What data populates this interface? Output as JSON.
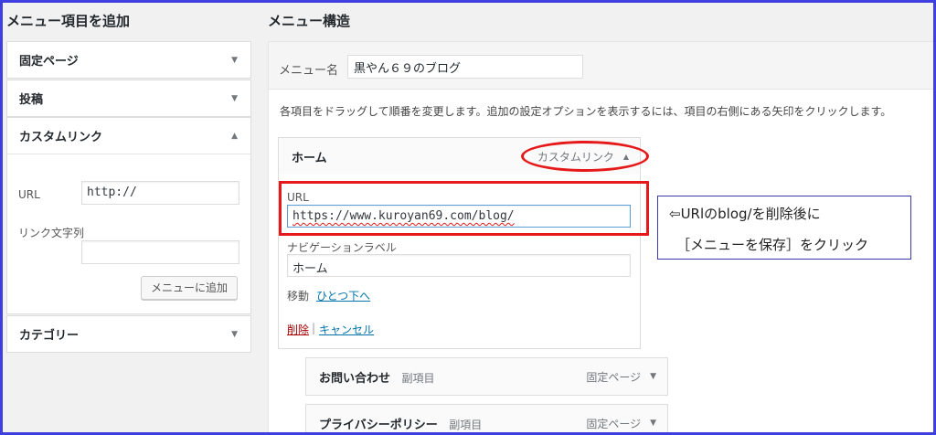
{
  "left": {
    "title": "メニュー項目を追加",
    "sections": {
      "pages": "固定ページ",
      "posts": "投稿",
      "custom_links": "カスタムリンク",
      "categories": "カテゴリー"
    },
    "custom_link_form": {
      "url_label": "URL",
      "url_value": "http://",
      "link_text_label": "リンク文字列",
      "link_text_value": "",
      "add_button": "メニューに追加"
    }
  },
  "right": {
    "title": "メニュー構造",
    "menu_name_label": "メニュー名",
    "menu_name_value": "黒やん６９のブログ",
    "help_text": "各項目をドラッグして順番を変更します。追加の設定オプションを表示するには、項目の右側にある矢印をクリックします。",
    "open_item": {
      "title": "ホーム",
      "type": "カスタムリンク",
      "url_label": "URL",
      "url_value": "https://www.kuroyan69.com/blog/",
      "nav_label_label": "ナビゲーションラベル",
      "nav_label_value": "ホーム",
      "move_label": "移動",
      "move_link": "ひとつ下へ",
      "remove_link": "削除",
      "separator": "|",
      "cancel_link": "キャンセル"
    },
    "items": [
      {
        "title": "お問い合わせ",
        "sub": "副項目",
        "type": "固定ページ"
      },
      {
        "title": "プライバシーポリシー",
        "sub": "副項目",
        "type": "固定ページ"
      }
    ]
  },
  "annotation": {
    "line1": "⇦URlのblog/を削除後に",
    "line2": "［メニューを保存］をクリック"
  },
  "icons": {
    "collapsed": "triangle-down-icon",
    "expanded": "triangle-up-icon"
  },
  "colors": {
    "highlight_red": "#e51919",
    "link_blue": "#0073aa",
    "frame_blue": "#3f3fe0"
  }
}
